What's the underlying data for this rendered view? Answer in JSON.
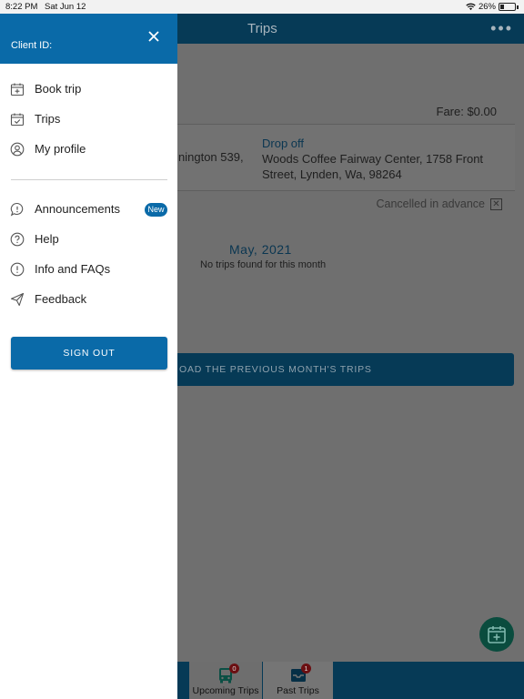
{
  "status_bar": {
    "time": "8:22 PM",
    "date": "Sat Jun 12",
    "battery": "26%",
    "battery_level": 0.26
  },
  "app": {
    "title": "Trips",
    "more_icon": "more-horizontal-icon",
    "trip": {
      "fare": "Fare: $0.00",
      "pickup_fragment": "nington 539,",
      "dropoff_label": "Drop off",
      "dropoff_address": "Woods Coffee Fairway Center, 1758 Front Street, Lynden, Wa, 98264",
      "status": "Cancelled in advance"
    },
    "month": {
      "title": "May, 2021",
      "empty_text": "No trips found for this month"
    },
    "load_button": "OAD THE PREVIOUS MONTH'S TRIPS",
    "tabs": [
      {
        "label": "Upcoming Trips",
        "badge": "0",
        "icon": "bus-icon"
      },
      {
        "label": "Past Trips",
        "badge": "1",
        "icon": "inbox-icon"
      }
    ]
  },
  "drawer": {
    "client_id_label": "Client ID:",
    "items": [
      {
        "label": "Book trip",
        "icon": "calendar-plus-icon"
      },
      {
        "label": "Trips",
        "icon": "calendar-check-icon"
      },
      {
        "label": "My profile",
        "icon": "user-circle-icon"
      },
      {
        "label": "Announcements",
        "icon": "speech-bubble-icon",
        "badge": "New"
      },
      {
        "label": "Help",
        "icon": "help-circle-icon"
      },
      {
        "label": "Info and FAQs",
        "icon": "info-circle-icon"
      },
      {
        "label": "Feedback",
        "icon": "send-icon"
      }
    ],
    "sign_out": "SIGN OUT"
  },
  "colors": {
    "brand": "#0a6aa8",
    "header_dark": "#063a56",
    "overlay": "#6f6f6f",
    "badge_red": "#c0171d",
    "fab": "#12876f"
  }
}
